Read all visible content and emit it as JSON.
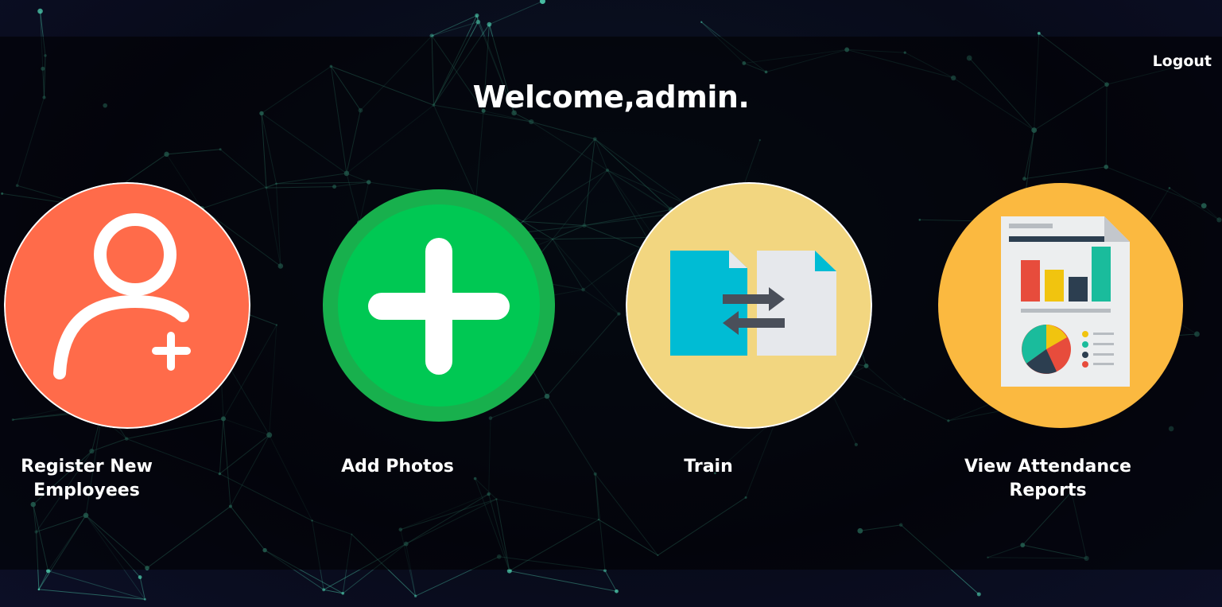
{
  "header": {
    "logout_label": "Logout",
    "welcome_text": "Welcome,admin."
  },
  "tiles": [
    {
      "label": "Register New Employees",
      "icon": "add-user-icon",
      "color": "#ff6b4a"
    },
    {
      "label": "Add Photos",
      "icon": "plus-icon",
      "color": "#00c853"
    },
    {
      "label": "Train",
      "icon": "file-transfer-icon",
      "color": "#f2d680"
    },
    {
      "label": "View Attendance Reports",
      "icon": "report-chart-icon",
      "color": "#fbb940"
    }
  ],
  "colors": {
    "background": "#0a0d1e",
    "network_lines": "#4fd0b0",
    "text": "#ffffff"
  }
}
